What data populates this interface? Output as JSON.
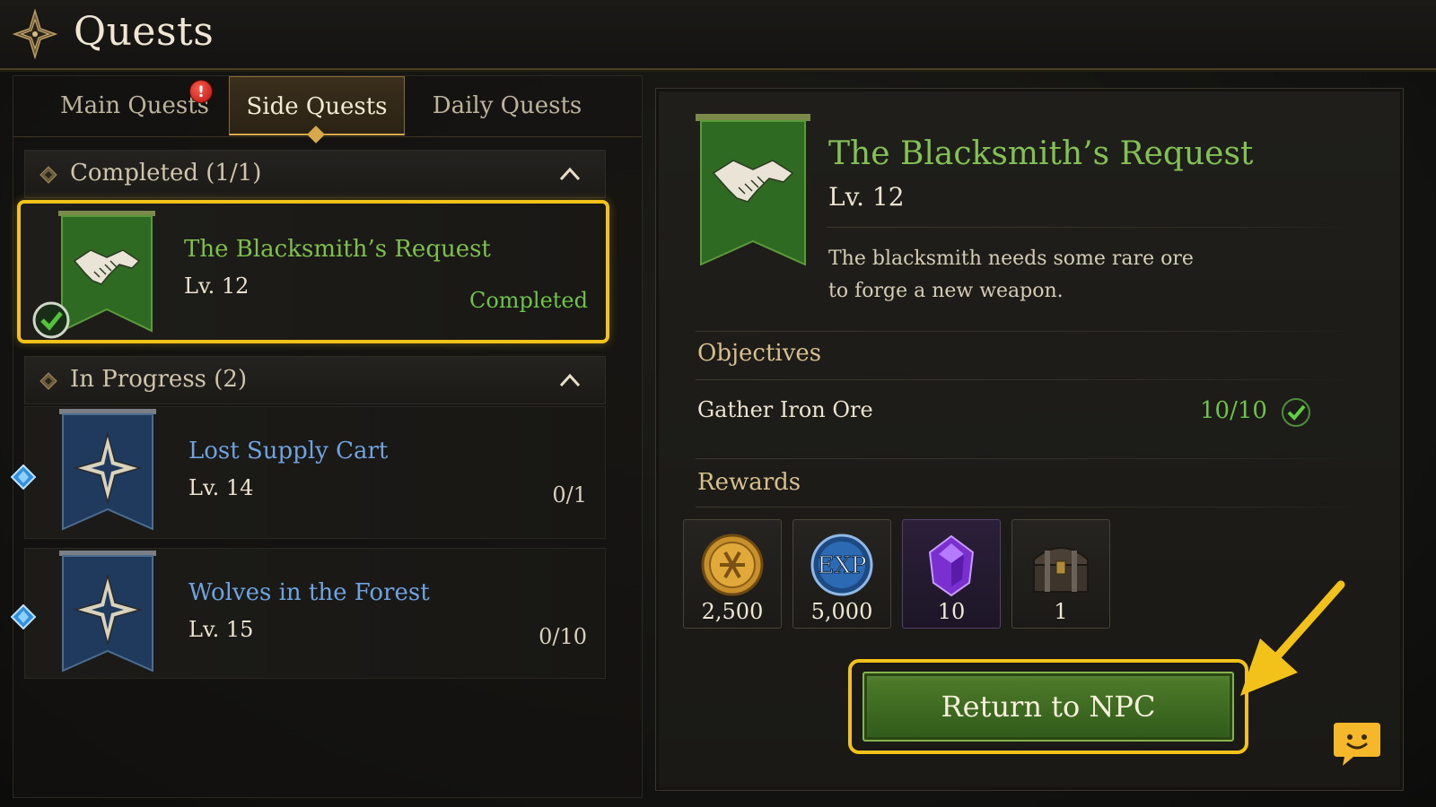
{
  "header": {
    "title": "Quests",
    "emblem_icon": "compass-star-icon"
  },
  "tabs": [
    {
      "label": "Main Quests",
      "alert": "!",
      "selected": false
    },
    {
      "label": "Side Quests",
      "selected": true
    },
    {
      "label": "Daily Quests",
      "selected": false
    }
  ],
  "sections": {
    "completed": {
      "label": "Completed (1/1)",
      "quests": [
        {
          "title": "The Blacksmith’s Request",
          "level": "Lv. 12",
          "status": "Completed",
          "banner": "handshake-icon",
          "banner_color": "#2f6a22",
          "selected": true
        }
      ]
    },
    "in_progress": {
      "label": "In Progress (2)",
      "quests": [
        {
          "title": "Lost Supply Cart",
          "level": "Lv. 14",
          "progress": "0/1",
          "banner": "compass-star-icon",
          "banner_color": "#1f3a5c"
        },
        {
          "title": "Wolves in the Forest",
          "level": "Lv. 15",
          "progress": "0/10",
          "banner": "compass-star-icon",
          "banner_color": "#1f3a5c"
        }
      ]
    }
  },
  "detail": {
    "title": "The Blacksmith’s Request",
    "level": "Lv. 12",
    "description": "The blacksmith needs some rare ore to forge a new weapon.",
    "objectives_heading": "Objectives",
    "objective": {
      "label": "Gather Iron Ore",
      "progress": "10/10",
      "complete": true
    },
    "rewards_heading": "Rewards",
    "rewards": [
      {
        "icon": "gold-coin-icon",
        "count": "2,500"
      },
      {
        "icon": "exp-orb-icon",
        "count": "5,000"
      },
      {
        "icon": "purple-gem-icon",
        "count": "10"
      },
      {
        "icon": "treasure-chest-icon",
        "count": "1"
      }
    ],
    "action_button": "Return to NPC"
  },
  "colors": {
    "accent_gold": "#f2c21b",
    "completed_green": "#6fc24a",
    "quest_blue": "#6fa3e0",
    "button_green": "#4f7d2a"
  }
}
